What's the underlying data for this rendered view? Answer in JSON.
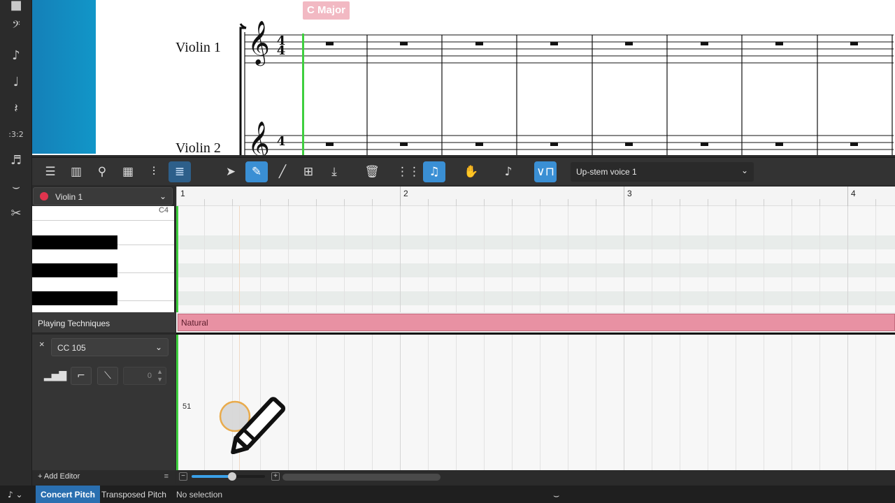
{
  "score": {
    "key_signature_label": "C Major",
    "staves": [
      {
        "name": "Violin 1",
        "clef": "𝄞",
        "time_sig_top": "4",
        "time_sig_bottom": "4"
      },
      {
        "name": "Violin 2",
        "clef": "𝄞",
        "time_sig_top": "4",
        "time_sig_bottom": "4"
      }
    ]
  },
  "key_editor": {
    "voice_select": "Up-stem voice 1",
    "instrument_select": "Violin 1",
    "instrument_color": "#e0344e",
    "ruler_bars": [
      "1",
      "2",
      "3",
      "4"
    ],
    "keyboard_label": "C4",
    "playing_techniques_label": "Playing Techniques",
    "playing_technique_value": "Natural",
    "cc_controller": "CC 105",
    "cc_close": "×",
    "cc_input_value": "0",
    "cc_readout": "51",
    "add_editor_label": "+ Add Editor",
    "footer_menu": "≡",
    "zoom_minus": "−",
    "zoom_plus": "+",
    "zoom_level_fraction": 0.55
  },
  "status_bar": {
    "concert_pitch": "Concert Pitch",
    "transposed_pitch": "Transposed Pitch",
    "selection": "No selection"
  },
  "colors": {
    "accent": "#3a8fd4",
    "playhead": "#3fcf3f",
    "technique_bar": "#e891a3",
    "key_label_bg": "#f2b9c3"
  },
  "icons": {
    "left_toolbar": [
      "note-input-icon",
      "clef-icon",
      "tie-icon",
      "quarter-note-icon",
      "rest-icon",
      "tuplet-icon",
      "grace-note-icon",
      "slur-icon",
      "scissors-icon"
    ],
    "key_editor_toolbar": [
      "list-icon",
      "piano-icon",
      "guitar-icon",
      "grid-icon",
      "mixer-icon",
      "key-editor-icon",
      "select-arrow-icon",
      "pencil-icon",
      "line-icon",
      "resize-icon",
      "insert-icon",
      "trash-icon",
      "waveform-icon",
      "note-icon",
      "hand-icon",
      "tie-tool-icon",
      "velocity-icon"
    ]
  }
}
